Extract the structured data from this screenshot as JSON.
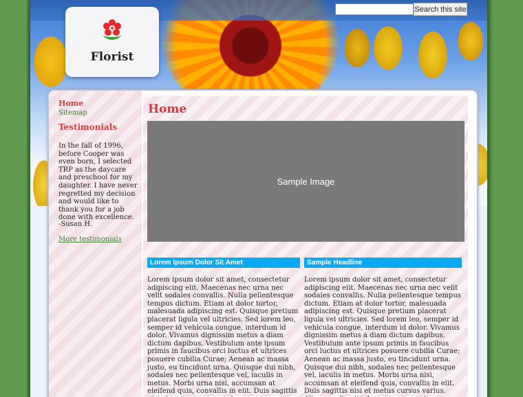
{
  "search": {
    "placeholder": "",
    "button_label": "Search this site"
  },
  "logo": {
    "text": "Florist",
    "icon": "flower-icon"
  },
  "sidebar": {
    "nav": [
      {
        "label": "Home",
        "active": true
      },
      {
        "label": "Sitemap",
        "active": false
      }
    ],
    "testimonials_title": "Testimonials",
    "quote": "In the fall of 1996, before Cooper was even born, I selected TRP as the daycare and preschool for my daughter. I have never regretted my decision and would like to thank you for a job done with excellence.",
    "author": "-Susan H.",
    "more_link": "More testimonials"
  },
  "main": {
    "title": "Home",
    "image_label": "Sample Image",
    "columns": [
      {
        "heading": "Lorem Ipsum Dolor Sit Amet",
        "body": "Lorem ipsum dolor sit amet, consectetur adipiscing elit. Maecenas nec urna nec velit sodales convallis. Nulla pellentesque tempus dictum. Etiam at dolor tortor, malesuada adipiscing est. Quisque pretium placerat ligula vel ultricies. Sed lorem leo, semper id vehicula congue, interdum id dolor. Vivamus dignissim metus a diam dictum dapibus. Vestibulum ante ipsum primis in faucibus orci luctus et ultrices posuere cubilia Curae; Aenean ac massa justo, eu tincidunt urna. Quisque dui nibh, sodales nec pellentesque vel, iaculis in metus. Morbi urna nisi, accumsan at eleifend quis, convallis in elit. Duis sagittis nisi et metus cursus varius."
      },
      {
        "heading": "Sample Headline",
        "body": "Lorem ipsum dolor sit amet, consectetur adipiscing elit. Maecenas nec urna nec velit sodales convallis. Nulla pellentesque tempus dictum. Etiam at dolor tortor, malesuada adipiscing est. Quisque pretium placerat ligula vel ultricies. Sed lorem leo, semper id vehicula congue, interdum id dolor. Vivamus dignissim metus a diam dictum dapibus. Vestibulum ante ipsum primis in faucibus orci luctus et ultrices posuere cubilia Curae; Aenean ac massa justo, eu tincidunt urna. Quisque dui nibh, sodales nec pellentesque vel, iaculis in metus. Morbi urna nisi, accumsan at eleifend quis, convallis in elit. Duis sagittis nisi et metus cursus varius. Aliquam vitae ligula eget urna pretium"
      }
    ]
  },
  "colors": {
    "background_green": "#5f9a4f",
    "accent_red": "#d23a3a",
    "link_green": "#3b7a2e",
    "column_header_blue": "#0aa9f1",
    "placeholder_gray": "#7a7a7a"
  }
}
